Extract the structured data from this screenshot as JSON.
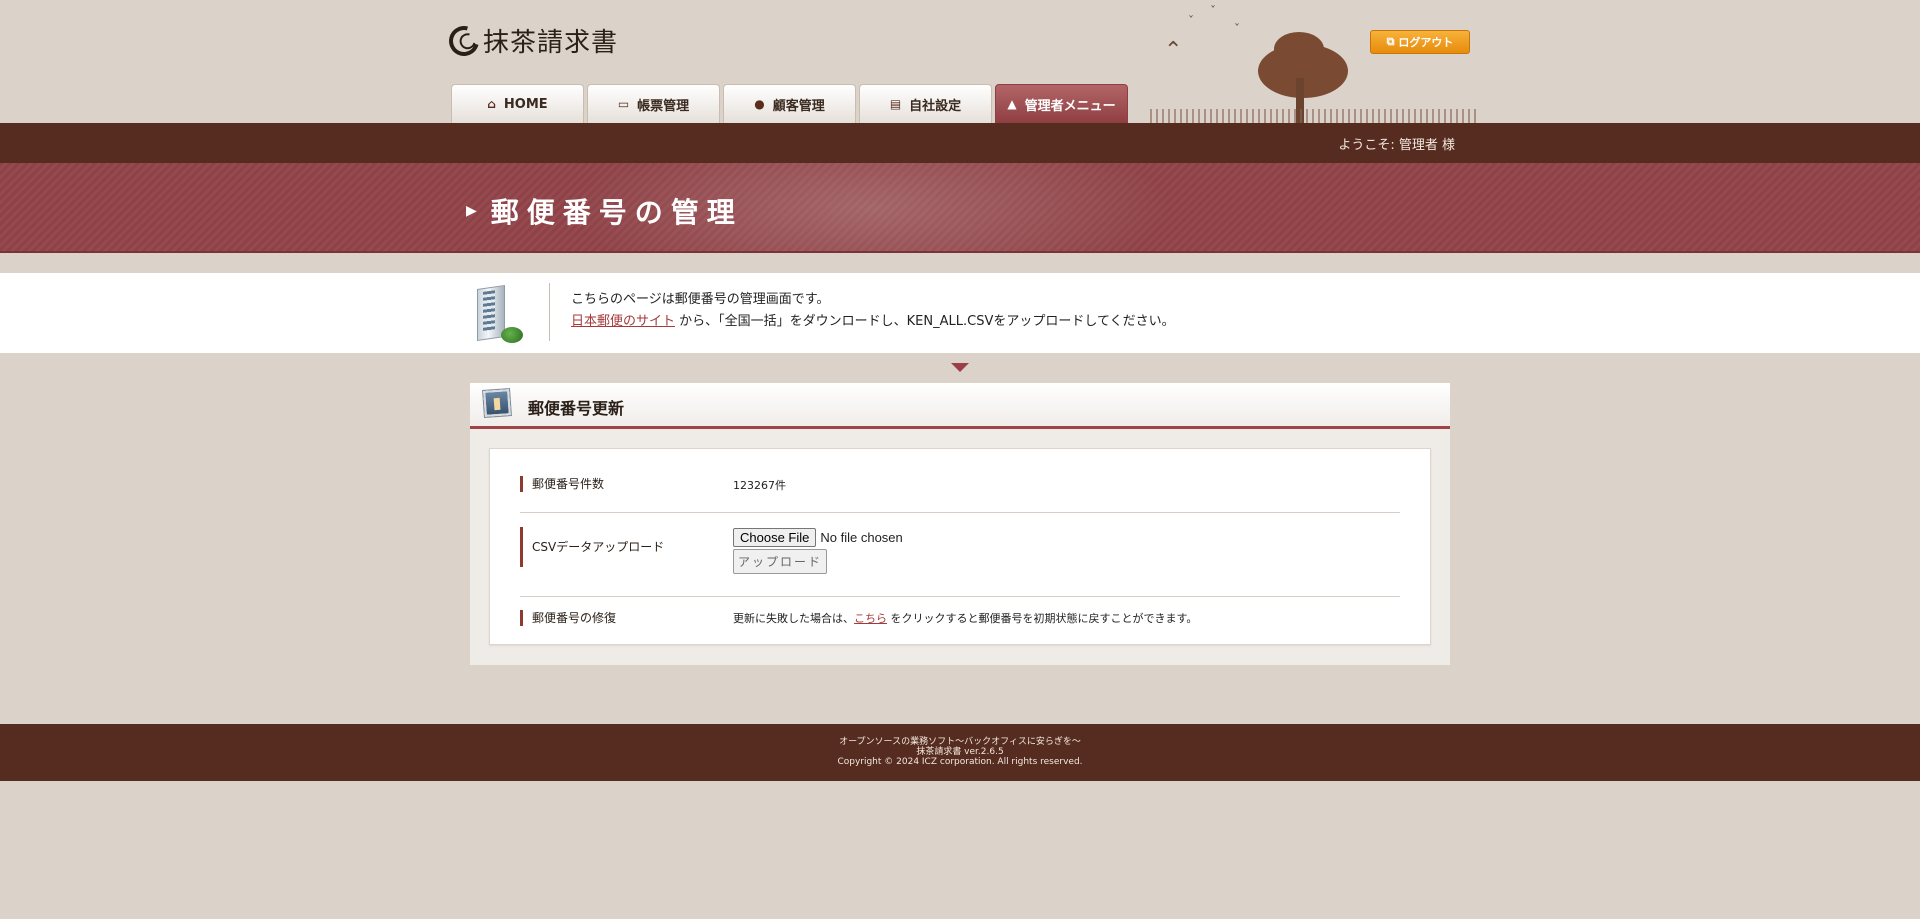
{
  "app": {
    "logo_text": "抹茶請求書"
  },
  "header": {
    "logout_label": "ログアウト",
    "tabs": [
      {
        "label": "HOME",
        "icon": "home-icon",
        "active": false
      },
      {
        "label": "帳票管理",
        "icon": "book-icon",
        "active": false
      },
      {
        "label": "顧客管理",
        "icon": "person-icon",
        "active": false
      },
      {
        "label": "自社設定",
        "icon": "company-icon",
        "active": false
      },
      {
        "label": "管理者メニュー",
        "icon": "lock-icon",
        "active": true
      }
    ],
    "welcome": "ようこそ: 管理者 様"
  },
  "page": {
    "title": "郵便番号の管理"
  },
  "info": {
    "line1": "こちらのページは郵便番号の管理画面です。",
    "link_text": "日本郵便のサイト",
    "line2_rest": " から、「全国一括」をダウンロードし、KEN_ALL.CSVをアップロードしてください。"
  },
  "panel": {
    "title": "郵便番号更新",
    "rows": {
      "count": {
        "label": "郵便番号件数",
        "value": "123267件"
      },
      "upload": {
        "label": "CSVデータアップロード",
        "choose_label": "Choose File",
        "no_file": "No file chosen",
        "upload_label": "アップロード"
      },
      "repair": {
        "label": "郵便番号の修復",
        "text_before": "更新に失敗した場合は、",
        "link_text": "こちら",
        "text_after": " をクリックすると郵便番号を初期状態に戻すことができます。"
      }
    }
  },
  "footer": {
    "line1": "オープンソースの業務ソフト～バックオフィスに安らぎを～",
    "line2": "抹茶請求書 ver.2.6.5",
    "line3": "Copyright © 2024 ICZ corporation. All rights reserved."
  },
  "colors": {
    "brand_brown": "#552c1f",
    "accent_red": "#944a4e",
    "logout_orange": "#f0a020"
  }
}
